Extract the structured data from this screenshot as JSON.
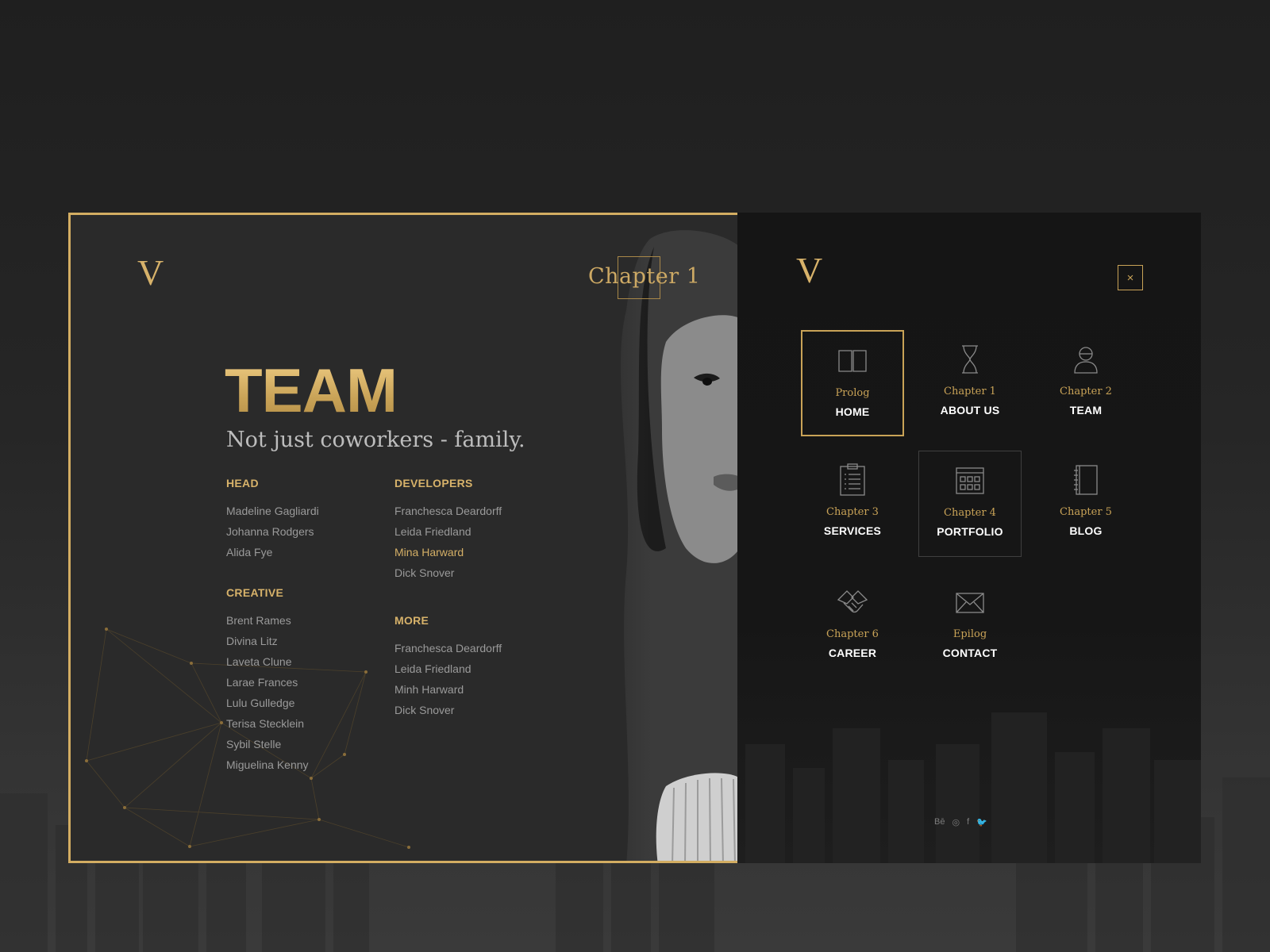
{
  "left": {
    "logo": "V",
    "chapter": "Chapter 1",
    "title": "TEAM",
    "subtitle": "Not just coworkers - family.",
    "groups": [
      {
        "heading": "HEAD",
        "members": [
          "Madeline Gagliardi",
          "Johanna Rodgers",
          "Alida Fye"
        ]
      },
      {
        "heading": "CREATIVE",
        "members": [
          "Brent Rames",
          "Divina Litz",
          "Laveta Clune",
          "Larae Frances",
          "Lulu Gulledge",
          "Terisa Stecklein",
          "Sybil Stelle",
          "Miguelina Kenny"
        ]
      },
      {
        "heading": "DEVELOPERS",
        "members": [
          "Franchesca Deardorff",
          "Leida Friedland",
          "Mina Harward",
          "Dick Snover"
        ]
      },
      {
        "heading": "MORE",
        "members": [
          "Franchesca Deardorff",
          "Leida Friedland",
          "Minh Harward",
          "Dick Snover"
        ]
      }
    ],
    "highlighted_member": "Mina Harward"
  },
  "menu": {
    "logo": "V",
    "close": "×",
    "items": [
      {
        "chapter": "Prolog",
        "label": "HOME",
        "icon": "book-icon"
      },
      {
        "chapter": "Chapter 1",
        "label": "ABOUT US",
        "icon": "hourglass-icon"
      },
      {
        "chapter": "Chapter 2",
        "label": "TEAM",
        "icon": "person-icon"
      },
      {
        "chapter": "Chapter 3",
        "label": "SERVICES",
        "icon": "clipboard-list-icon"
      },
      {
        "chapter": "Chapter 4",
        "label": "PORTFOLIO",
        "icon": "grid-window-icon"
      },
      {
        "chapter": "Chapter 5",
        "label": "BLOG",
        "icon": "notebook-icon"
      },
      {
        "chapter": "Chapter 6",
        "label": "CAREER",
        "icon": "handshake-icon"
      },
      {
        "chapter": "Epilog",
        "label": "CONTACT",
        "icon": "envelope-icon"
      }
    ],
    "selected": "HOME",
    "hovered": "PORTFOLIO",
    "social": [
      "Bē",
      "◎",
      "f",
      "🐦"
    ]
  },
  "colors": {
    "accent": "#d3ad62",
    "panel_dark": "#151515",
    "panel_left": "#2a2a2a"
  }
}
